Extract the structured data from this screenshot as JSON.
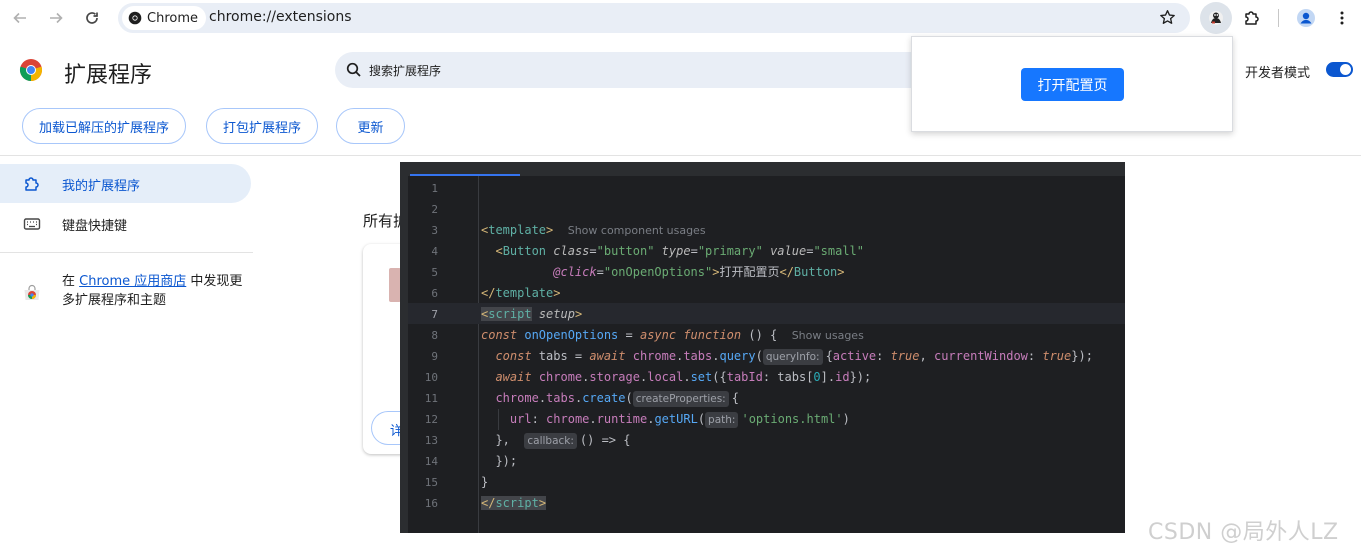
{
  "browser": {
    "chip_label": "Chrome",
    "url": "chrome://extensions"
  },
  "header": {
    "title": "扩展程序",
    "search_placeholder": "搜索扩展程序",
    "devmode_label": "开发者模式",
    "devmode_on": true
  },
  "actions": {
    "load_unpacked": "加载已解压的扩展程序",
    "pack": "打包扩展程序",
    "update": "更新"
  },
  "sidebar": {
    "items": [
      {
        "label": "我的扩展程序",
        "active": true
      },
      {
        "label": "键盘快捷键",
        "active": false
      }
    ],
    "webstore_prefix": "在 ",
    "webstore_link": "Chrome 应用商店",
    "webstore_suffix": " 中发现更多扩展程序和主题"
  },
  "main": {
    "section_title_partial": "所有扩",
    "card_button_partial": "详"
  },
  "popup": {
    "button_label": "打开配置页"
  },
  "editor": {
    "current_line": 7,
    "line_numbers": [
      "1",
      "2",
      "3",
      "4",
      "5",
      "6",
      "7",
      "8",
      "9",
      "10",
      "11",
      "12",
      "13",
      "14",
      "15",
      "16"
    ],
    "show_component_usages": "Show component usages",
    "show_usages": "Show usages",
    "hints": {
      "queryInfo": "queryInfo:",
      "createProperties": "createProperties:",
      "path": "path:",
      "callback": "callback:"
    }
  },
  "watermark": "CSDN @局外人LZ",
  "colors": {
    "accent": "#0b57d0",
    "popup_button": "#1677ff",
    "editor_bg": "#1e1f22"
  }
}
